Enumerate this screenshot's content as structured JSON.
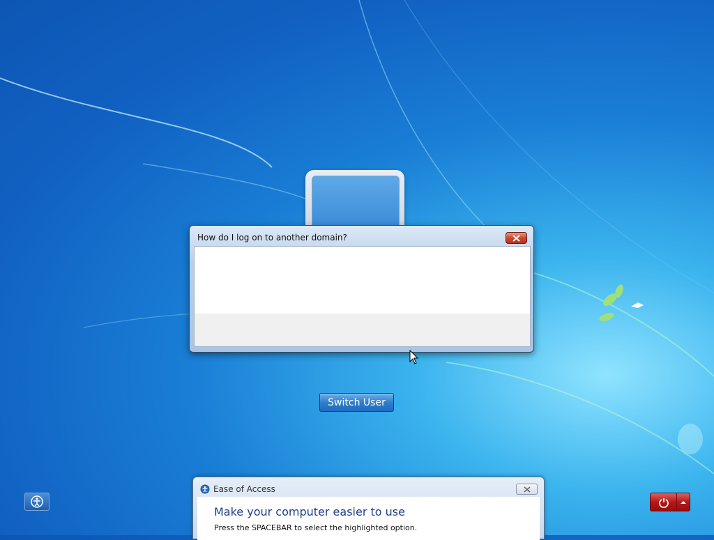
{
  "dialog": {
    "title": "How do I log on to another domain?",
    "close_icon": "close-icon"
  },
  "logon": {
    "switch_user_label": "Switch User"
  },
  "ease_of_access": {
    "button_icon": "ease-of-access-icon",
    "panel_title": "Ease of Access",
    "heading": "Make your computer easier to use",
    "instruction": "Press the SPACEBAR to select the highlighted option."
  },
  "power": {
    "power_icon": "power-icon",
    "options_icon": "chevron-up-icon"
  },
  "colors": {
    "accent": "#1a7fd6",
    "close_red": "#c84a30",
    "power_red": "#b51818",
    "heading_blue": "#1e3f8a"
  }
}
